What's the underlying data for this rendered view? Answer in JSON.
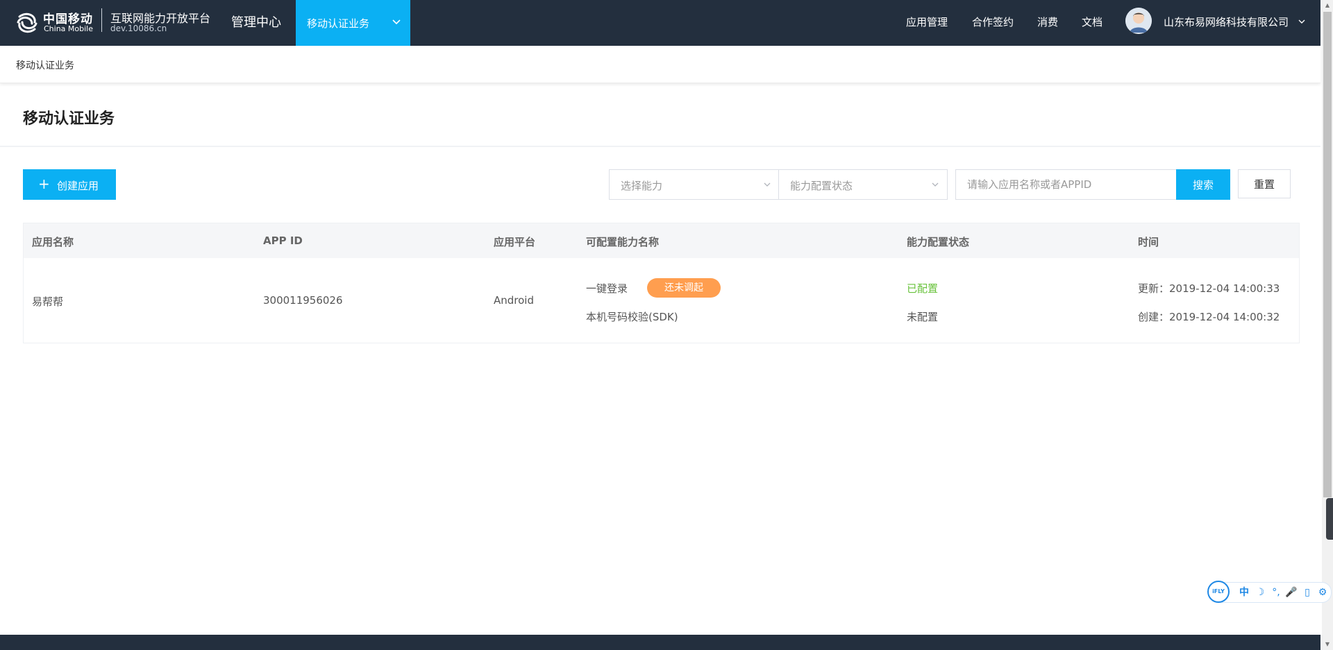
{
  "header": {
    "brand_cn": "中国移动",
    "brand_en": "China Mobile",
    "platform_title": "互联网能力开放平台",
    "platform_domain": "dev.10086.cn",
    "mgmt_center": "管理中心",
    "active_nav": "移动认证业务",
    "nav_links": [
      "应用管理",
      "合作签约",
      "消费",
      "文档"
    ],
    "company": "山东布易网络科技有限公司"
  },
  "breadcrumb": "移动认证业务",
  "page_title": "移动认证业务",
  "toolbar": {
    "create_label": "创建应用",
    "select_capability_placeholder": "选择能力",
    "select_status_placeholder": "能力配置状态",
    "search_placeholder": "请输入应用名称或者APPID",
    "search_label": "搜索",
    "reset_label": "重置"
  },
  "table": {
    "headers": [
      "应用名称",
      "APP ID",
      "应用平台",
      "可配置能力名称",
      "能力配置状态",
      "时间"
    ],
    "rows": [
      {
        "app_name": "易帮帮",
        "app_id": "300011956026",
        "platform": "Android",
        "capability_1": "一键登录",
        "capability_1_badge": "还未调起",
        "capability_2": "本机号码校验(SDK)",
        "status_1": "已配置",
        "status_2": "未配置",
        "updated": "更新：2019-12-04 14:00:33",
        "created": "创建：2019-12-04 14:00:32"
      }
    ]
  },
  "ime": {
    "logo": "iFLY",
    "items": [
      "中",
      "☽",
      "°,",
      "🎤",
      "▯",
      "⚙"
    ]
  },
  "colors": {
    "header_bg": "#232f3e",
    "accent": "#0bb0f3",
    "badge_orange": "#ff9e4f",
    "status_green": "#67c23a"
  },
  "icons": [
    "china-mobile-logo-icon",
    "chevron-down-icon",
    "plus-icon",
    "avatar-icon"
  ]
}
